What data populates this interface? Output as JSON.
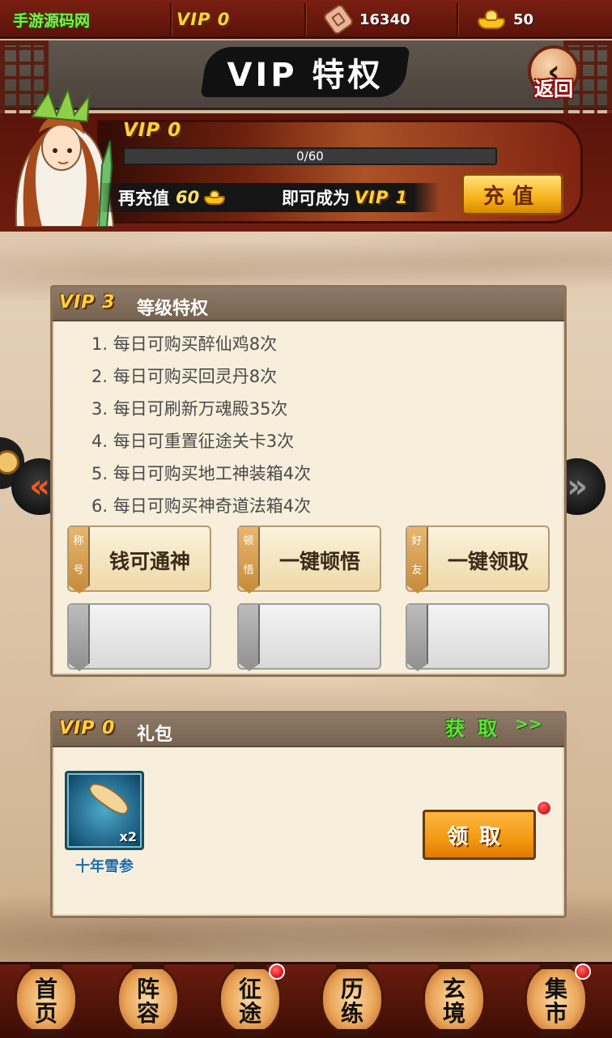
{
  "topbar": {
    "brand": "手游源码网",
    "vip": "VIP 0",
    "coupons": "16340",
    "ingots": "50"
  },
  "header": {
    "title": "VIP 特权",
    "back_label": "返回"
  },
  "vip_progress": {
    "current_vip": "VIP 0",
    "progress_text": "0/60",
    "progress_fraction": 0,
    "recharge_prefix": "再充值",
    "recharge_amount": "60",
    "recharge_suffix": "即可成为",
    "next_vip": "VIP 1",
    "charge_button": "充值"
  },
  "privileges": {
    "level": "VIP 3",
    "title": "等级特权",
    "items": [
      "1. 每日可购买醉仙鸡8次",
      "2. 每日可购买回灵丹8次",
      "3. 每日可刷新万魂殿35次",
      "4. 每日可重置征途关卡3次",
      "5. 每日可购买地工神装箱4次",
      "6. 每日可购买神奇道法箱4次"
    ],
    "tiles": [
      {
        "tag": [
          "称",
          "号"
        ],
        "label": "钱可通神"
      },
      {
        "tag": [
          "顿",
          "悟"
        ],
        "label": "一键顿悟"
      },
      {
        "tag": [
          "好",
          "友"
        ],
        "label": "一键领取"
      }
    ]
  },
  "gift": {
    "level": "VIP 0",
    "title": "礼包",
    "get_label": "获取",
    "get_arrow": ">>",
    "item_name": "十年雪参",
    "item_count": "x2",
    "claim_button": "领取"
  },
  "nav": [
    {
      "label": "首页",
      "badge": false
    },
    {
      "label": "阵容",
      "badge": false
    },
    {
      "label": "征途",
      "badge": true
    },
    {
      "label": "历练",
      "badge": false
    },
    {
      "label": "玄境",
      "badge": false
    },
    {
      "label": "集市",
      "badge": true
    }
  ],
  "colors": {
    "accent_gold": "#ffd23a",
    "brand_green": "#7ff04d",
    "badge_red": "#e01212",
    "item_name_blue": "#1c6aa6"
  }
}
